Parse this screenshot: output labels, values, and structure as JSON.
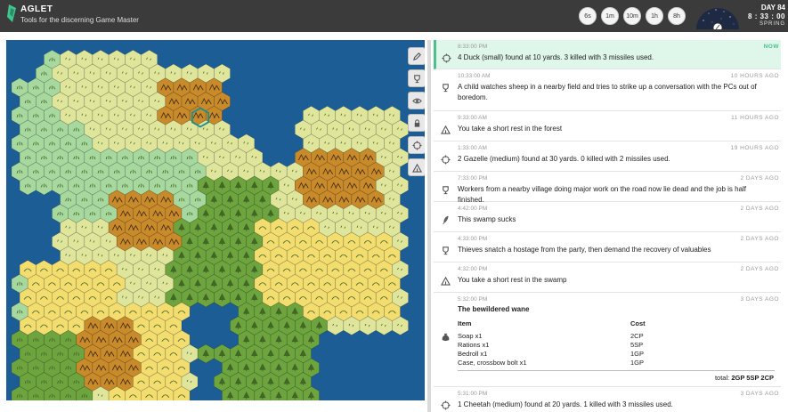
{
  "app": {
    "name": "AGLET",
    "tagline": "Tools for the discerning Game Master"
  },
  "time_buttons": [
    "6s",
    "1m",
    "10m",
    "1h",
    "8h"
  ],
  "clock": {
    "day": "DAY 84",
    "time": "8 : 33 : 00",
    "season": "SPRING"
  },
  "map_tools": [
    "pencil-icon",
    "trophy-icon",
    "eye-icon",
    "lock-icon",
    "target-icon",
    "tent-icon"
  ],
  "log": [
    {
      "time": "8:33:00 PM",
      "ago": "NOW",
      "icon": "crosshair-icon",
      "text": "4 Duck (small) found at 10 yards. 3 killed with 3 missiles used."
    },
    {
      "time": "10:33:00 AM",
      "ago": "10 HOURS AGO",
      "icon": "trophy-icon",
      "text": "A child watches sheep in a nearby field and tries to strike up a conversation with the PCs out of boredom."
    },
    {
      "time": "9:33:00 AM",
      "ago": "11 HOURS AGO",
      "icon": "tent-icon",
      "text": "You take a short rest in the forest"
    },
    {
      "time": "1:33:00 AM",
      "ago": "19 HOURS AGO",
      "icon": "crosshair-icon",
      "text": "2 Gazelle (medium) found at 30 yards. 0 killed with 2 missiles used."
    },
    {
      "time": "7:33:00 PM",
      "ago": "2 DAYS AGO",
      "icon": "trophy-icon",
      "text": "Workers from a nearby village doing major work on the road now lie dead and the job is half finished."
    },
    {
      "time": "4:42:00 PM",
      "ago": "2 DAYS AGO",
      "icon": "quill-icon",
      "text": "This swamp sucks"
    },
    {
      "time": "4:33:00 PM",
      "ago": "2 DAYS AGO",
      "icon": "trophy-icon",
      "text": "Thieves snatch a hostage from the party, then demand the recovery of valuables"
    },
    {
      "time": "4:32:00 PM",
      "ago": "2 DAYS AGO",
      "icon": "tent-icon",
      "text": "You take a short rest in the swamp"
    }
  ],
  "purchase": {
    "time": "5:32:00 PM",
    "ago": "3 DAYS AGO",
    "icon": "moneybag-icon",
    "title": "The bewildered wane",
    "col_item": "Item",
    "col_cost": "Cost",
    "rows": [
      {
        "item": "Soap x1",
        "cost": "2CP"
      },
      {
        "item": "Rations x1",
        "cost": "5SP"
      },
      {
        "item": "Bedroll x1",
        "cost": "1GP"
      },
      {
        "item": "Case, crossbow bolt x1",
        "cost": "1GP"
      }
    ],
    "total_label": "total:",
    "total_value": "2GP 5SP 2CP"
  },
  "last_entry": {
    "time": "5:31:00 PM",
    "ago": "3 DAYS AGO",
    "icon": "crosshair-icon",
    "text": "1 Cheetah (medium) found at 20 yards. 1 killed with 3 missiles used."
  },
  "colors": {
    "header": "#3b3b3b",
    "water": "#1b5d94",
    "grassland": "#a7d89e",
    "plains": "#dfe59a",
    "desert": "#f2dd6e",
    "mountains": "#c98a2a",
    "forest": "#6ea43e",
    "swamp": "#6ea43e",
    "highlight": "#dff6ea",
    "accent": "#4cc08b"
  }
}
